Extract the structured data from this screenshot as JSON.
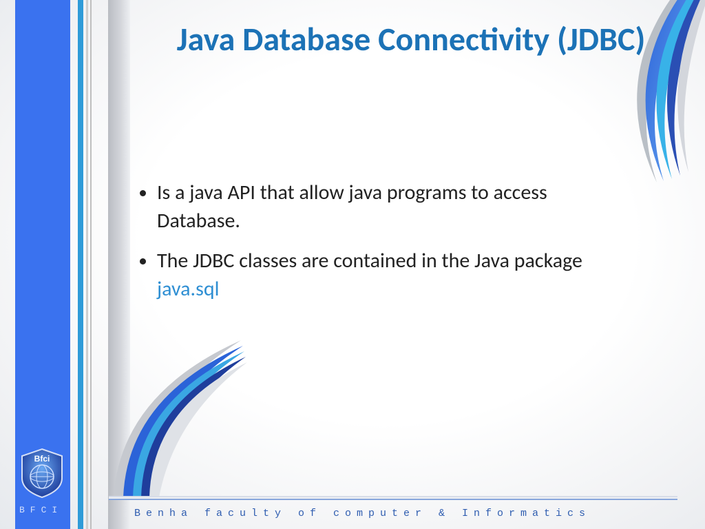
{
  "title": "Java Database Connectivity (JDBC)",
  "bullets": [
    {
      "text": "Is a java API that allow java programs to access Database."
    },
    {
      "prefix": "The JDBC classes are contained in the Java package ",
      "highlight": "java.sql"
    }
  ],
  "footer": "Benha faculty of computer & Informatics",
  "sidebar_label": "BFCI",
  "logo_text": "Bfci",
  "colors": {
    "title": "#1c72b6",
    "highlight": "#2f8fd3",
    "sidebar": "#3a72ef"
  }
}
